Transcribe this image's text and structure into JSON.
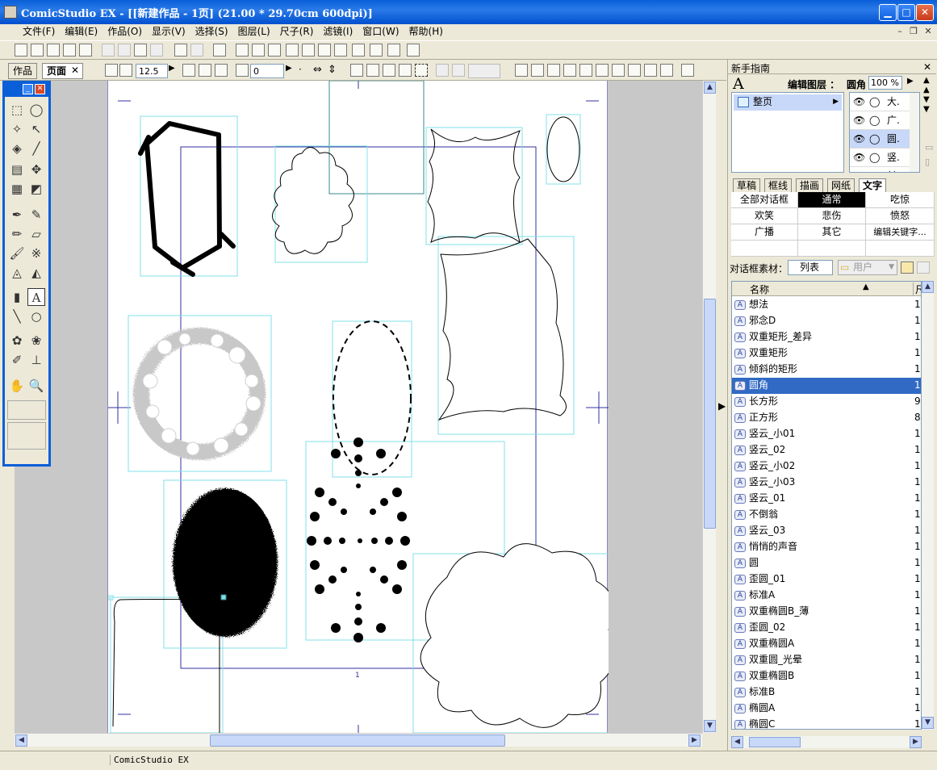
{
  "window": {
    "title": "ComicStudio EX - [[新建作品 - 1页] (21.00 * 29.70cm 600dpi)]"
  },
  "menu": [
    "文件(F)",
    "编辑(E)",
    "作品(O)",
    "显示(V)",
    "选择(S)",
    "图层(L)",
    "尺子(R)",
    "滤镜(I)",
    "窗口(W)",
    "帮助(H)"
  ],
  "tabs": {
    "work": "作品",
    "page": "页面"
  },
  "toolbar": {
    "zoom_value": "12.5",
    "rotate_value": "0"
  },
  "status": {
    "text": "ComicStudio EX"
  },
  "page_marker": "1",
  "panel": {
    "title": "新手指南",
    "edit_layer_label": "编辑图层 ：",
    "edit_layer_value": "圆角",
    "opacity": "100 %",
    "layer_folder": "整页",
    "layers": [
      "大.",
      "广.",
      "圆.",
      "竖.",
      "长"
    ],
    "category_tabs": [
      "草稿",
      "框线",
      "描画",
      "网纸",
      "文字"
    ],
    "balloon_categories": [
      [
        "全部对话框",
        "通常",
        "吃惊"
      ],
      [
        "欢笑",
        "悲伤",
        "愤怒"
      ],
      [
        "广播",
        "其它",
        "编辑关键字..."
      ]
    ],
    "material_label": "对话框素材：",
    "material_view": "列表",
    "material_folder": "用户",
    "col_name": "名称",
    "col_size": "尺",
    "materials": [
      [
        "想法",
        "1"
      ],
      [
        "邪念D",
        "1"
      ],
      [
        "双重矩形_差异",
        "1"
      ],
      [
        "双重矩形",
        "1"
      ],
      [
        "倾斜的矩形",
        "1"
      ],
      [
        "圆角",
        "1"
      ],
      [
        "长方形",
        "9"
      ],
      [
        "正方形",
        "8"
      ],
      [
        "竖云_小01",
        "1"
      ],
      [
        "竖云_02",
        "1"
      ],
      [
        "竖云_小02",
        "1"
      ],
      [
        "竖云_小03",
        "1"
      ],
      [
        "竖云_01",
        "1"
      ],
      [
        "不倒翁",
        "1"
      ],
      [
        "竖云_03",
        "1"
      ],
      [
        "悄悄的声音",
        "1"
      ],
      [
        "圆",
        "1"
      ],
      [
        "歪圆_01",
        "1"
      ],
      [
        "标准A",
        "1"
      ],
      [
        "双重椭圆B_薄",
        "1"
      ],
      [
        "歪圆_02",
        "1"
      ],
      [
        "双重椭圆A",
        "1"
      ],
      [
        "双重圆_光晕",
        "1"
      ],
      [
        "双重椭圆B",
        "1"
      ],
      [
        "标准B",
        "1"
      ],
      [
        "椭圆A",
        "1"
      ],
      [
        "椭圆C",
        "1"
      ]
    ]
  },
  "colors": {
    "title_blue": "#0a5fd8",
    "selection": "#316ac5",
    "frame_cyan": "#80e0e8",
    "ruler_navy": "#3030a0"
  }
}
